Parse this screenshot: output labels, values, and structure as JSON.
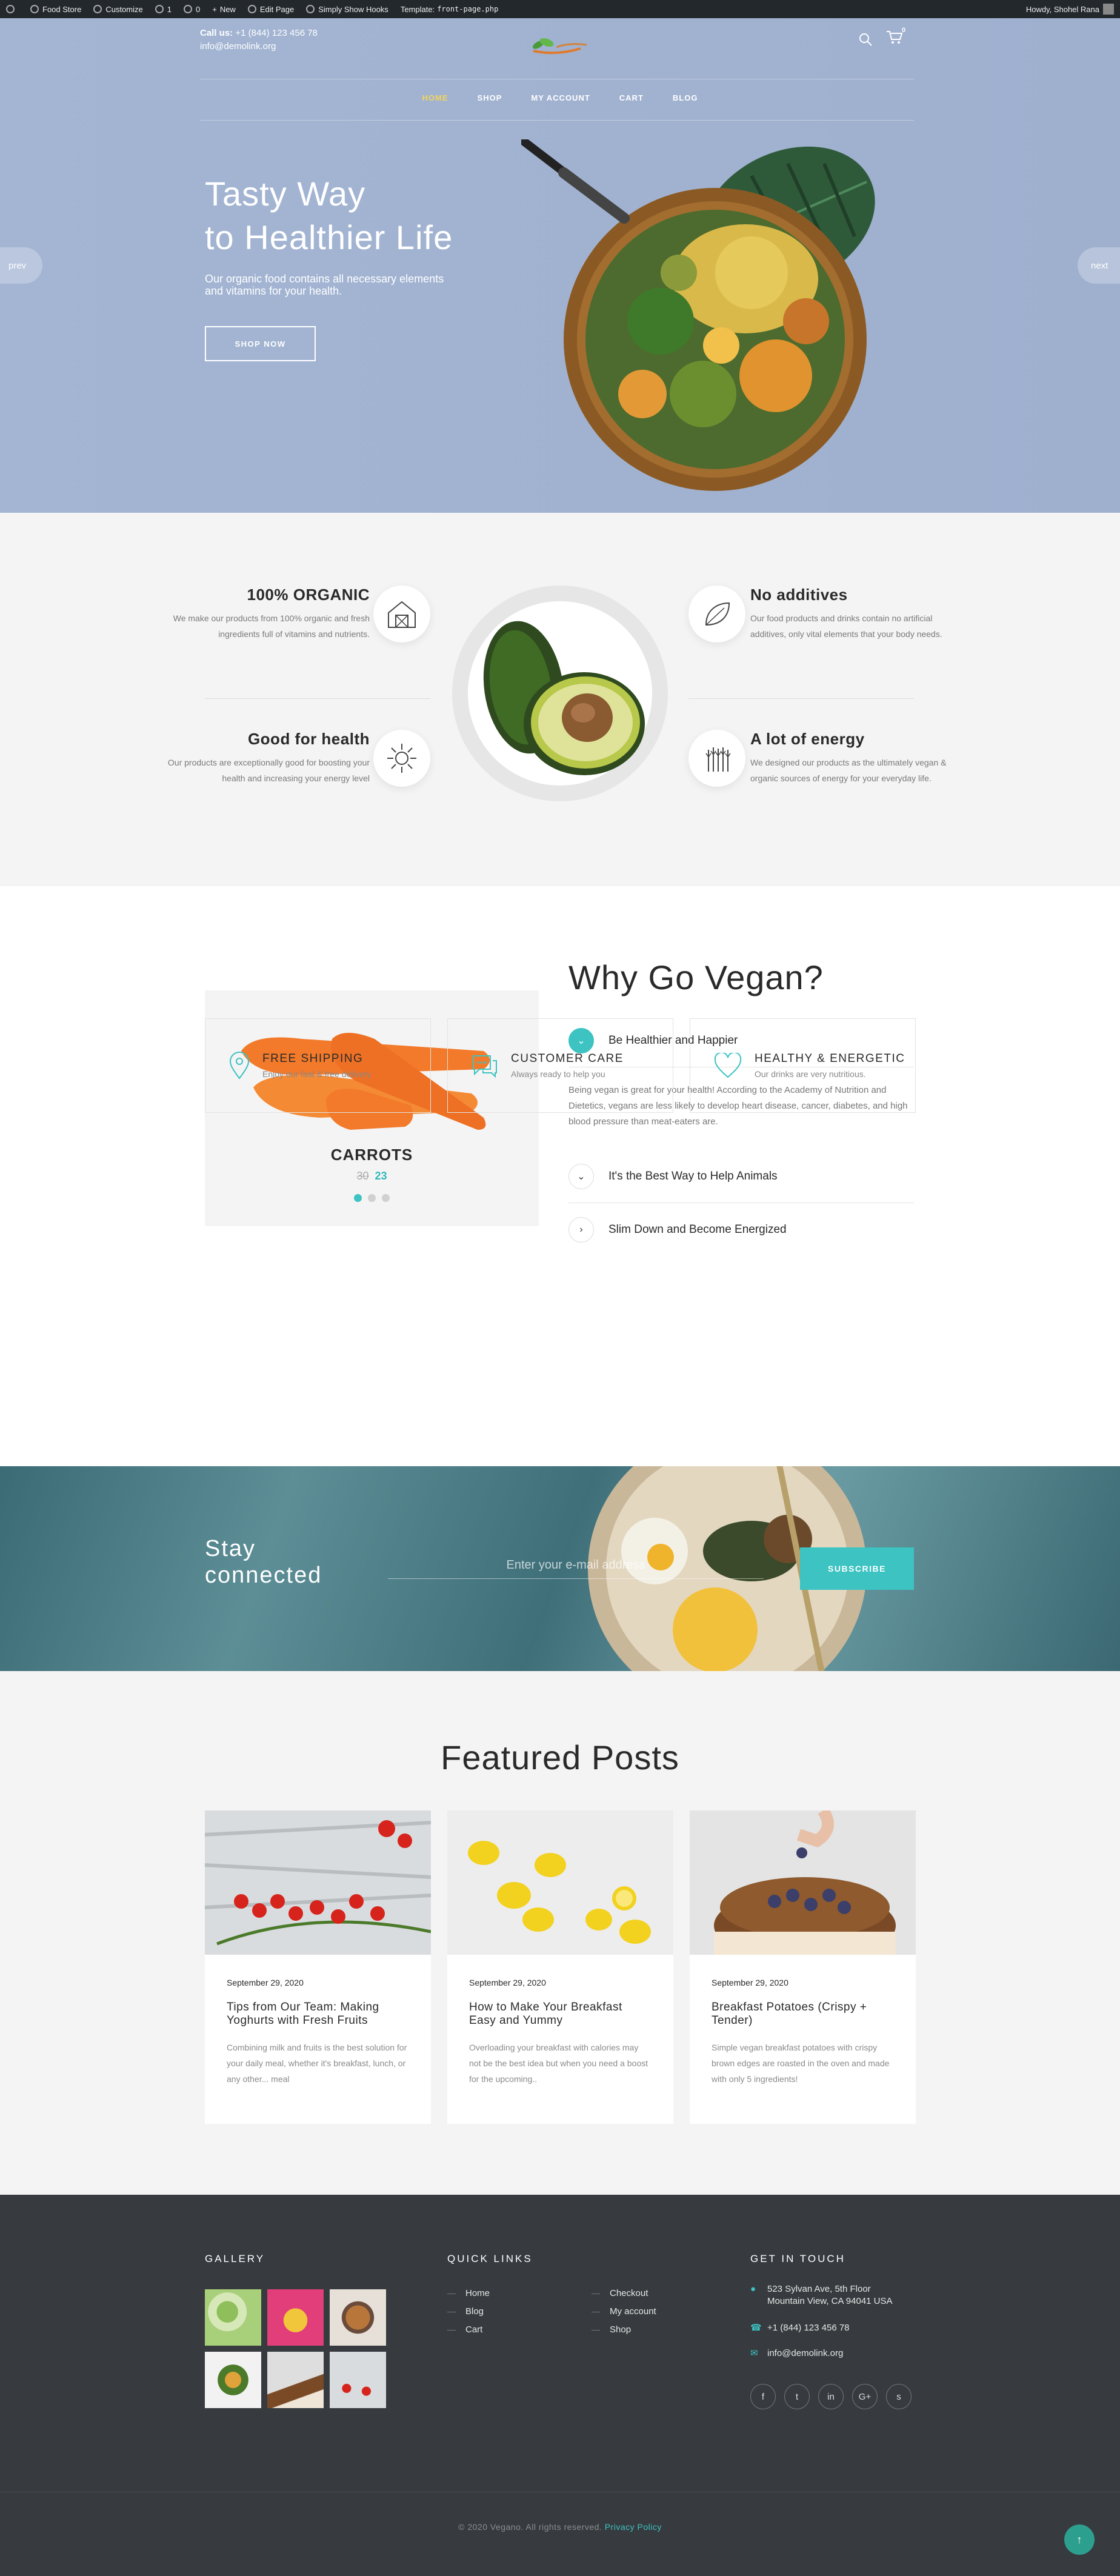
{
  "admin_bar": {
    "items": [
      "Food Store",
      "Customize",
      "1",
      "0",
      "New",
      "Edit Page",
      "Simply Show Hooks"
    ],
    "template_label": "Template:",
    "template_file": "front-page.php",
    "howdy": "Howdy, Shohel Rana"
  },
  "header": {
    "call_label": "Call us:",
    "phone": "+1 (844) 123 456 78",
    "email": "info@demolink.org",
    "cart_count": "0",
    "nav": [
      "HOME",
      "SHOP",
      "MY ACCOUNT",
      "CART",
      "BLOG"
    ]
  },
  "hero": {
    "title_line1": "Tasty Way",
    "title_line2": "to Healthier Life",
    "subtitle": "Our organic food contains all necessary elements and vitamins for your health.",
    "button": "SHOP NOW",
    "prev": "prev",
    "next": "next"
  },
  "features": {
    "items": [
      {
        "title": "100% ORGANIC",
        "text": "We make our products from 100% organic and fresh ingredients full of vitamins and nutrients.",
        "icon": "barn-icon"
      },
      {
        "title": "No additives",
        "text": "Our food products and drinks contain no artificial additives, only vital elements that your body needs.",
        "icon": "leaf-icon"
      },
      {
        "title": "Good for health",
        "text": "Our products are exceptionally good for boosting your health and increasing your energy level",
        "icon": "sun-icon"
      },
      {
        "title": "A lot of energy",
        "text": "We designed our products as the ultimately vegan & organic sources of energy for your everyday life.",
        "icon": "wheat-icon"
      }
    ]
  },
  "vegan": {
    "product_name": "CARROTS",
    "old_price": "30",
    "new_price": "23",
    "title": "Why Go Vegan?",
    "accordion": [
      {
        "title": "Be Healthier and Happier",
        "body": "Being vegan is great for your health! According to the Academy of Nutrition and Dietetics, vegans are less likely to develop heart disease, cancer, diabetes, and high blood pressure than meat-eaters are."
      },
      {
        "title": "It's the Best Way to Help Animals"
      },
      {
        "title": "Slim Down and Become Energized"
      }
    ]
  },
  "services": [
    {
      "title": "FREE SHIPPING",
      "desc": "Enjoy our fast & free delivery",
      "icon": "map-pin-icon"
    },
    {
      "title": "CUSTOMER CARE",
      "desc": "Always ready to help you",
      "icon": "chat-icon"
    },
    {
      "title": "HEALTHY & ENERGETIC",
      "desc": "Our drinks are very nutritious.",
      "icon": "heart-icon"
    }
  ],
  "newsletter": {
    "title_line1": "Stay",
    "title_line2": "connected",
    "placeholder": "Enter your e-mail address",
    "button": "SUBSCRIBE"
  },
  "posts": {
    "title": "Featured Posts",
    "items": [
      {
        "date": "September 29, 2020",
        "title": "Tips from Our Team: Making Yoghurts with Fresh Fruits",
        "excerpt": "Combining milk and fruits is the best solution for your daily meal, whether it's breakfast, lunch, or any other... meal"
      },
      {
        "date": "September 29, 2020",
        "title": "How to Make Your Breakfast Easy and Yummy",
        "excerpt": "Overloading your breakfast with calories may not be the best idea but when you need a boost for the upcoming.."
      },
      {
        "date": "September 29, 2020",
        "title": "Breakfast Potatoes (Crispy + Tender)",
        "excerpt": "Simple vegan breakfast potatoes with crispy brown edges are roasted in the oven and made with only 5 ingredients!"
      }
    ]
  },
  "footer": {
    "gallery_title": "GALLERY",
    "quick_links_title": "QUICK LINKS",
    "links_col1": [
      "Home",
      "Blog",
      "Cart"
    ],
    "links_col2": [
      "Checkout",
      "My account",
      "Shop"
    ],
    "contact_title": "GET IN TOUCH",
    "address_line1": "523 Sylvan Ave, 5th Floor",
    "address_line2": "Mountain View, CA 94041 USA",
    "phone": "+1 (844) 123 456 78",
    "email": "info@demolink.org",
    "socials": [
      "f",
      "t",
      "in",
      "G+",
      "s"
    ],
    "copyright": "© 2020 Vegano. All rights reserved.",
    "privacy": "Privacy Policy"
  },
  "colors": {
    "accent": "#3cc3c2",
    "hero_bg": "#a3b5d3",
    "footer_bg": "#373b3f",
    "nav_active": "#f2d45b"
  }
}
